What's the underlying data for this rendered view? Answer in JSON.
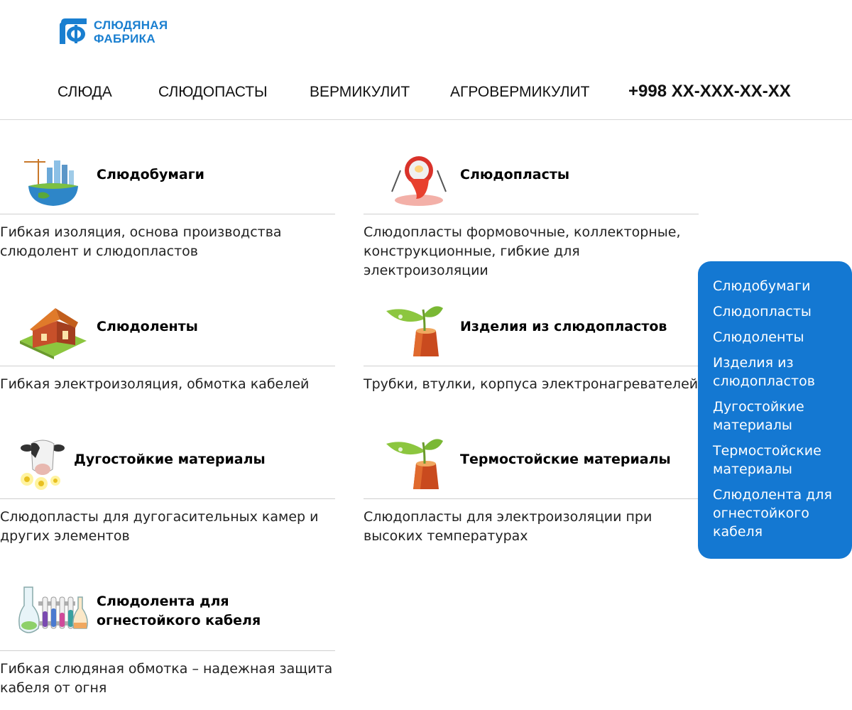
{
  "logo": {
    "line1": "СЛЮДЯНАЯ",
    "line2": "ФАБРИКА"
  },
  "nav": {
    "items": [
      "СЛЮДА",
      "СЛЮДОПАСТЫ",
      "ВЕРМИКУЛИТ",
      "АГРОВЕРМИКУЛИТ"
    ],
    "phone": "+998 XX-XXX-XX-XX"
  },
  "cards": [
    {
      "title": "Слюдобумаги",
      "description": "Гибкая изоляция, основа производства слюдолент и слюдопластов",
      "icon": "globe-city-icon"
    },
    {
      "title": "Слюдопласты",
      "description": "Слюдопласты формовочные, коллекторные, конструкционные, гибкие для электроизоляции",
      "icon": "lab-flask-icon"
    },
    {
      "title": "Слюдоленты",
      "description": "Гибкая электроизоляция, обмотка кабелей",
      "icon": "house-icon"
    },
    {
      "title": "Изделия из слюдопластов",
      "description": "Трубки, втулки, корпуса электронагревателей",
      "icon": "sprout-stump-icon"
    },
    {
      "title": "Дугостойкие материалы",
      "description": "Слюдопласты для дугогасительных камер и других элементов",
      "icon": "cow-flowers-icon"
    },
    {
      "title": "Термостойские материалы",
      "description": "Слюдопласты для электроизоляции при высоких температурах",
      "icon": "sprout-stump-icon"
    },
    {
      "title": "Слюдолента для огнестойкого кабеля",
      "description": "Гибкая слюдяная обмотка – надежная защита кабеля от огня",
      "icon": "test-tubes-icon"
    }
  ],
  "sidebar": {
    "items": [
      "Слюдобумаги",
      "Слюдопласты",
      "Слюдоленты",
      "Изделия из слюдопластов",
      "Дугостойкие материалы",
      "Термостойские материалы",
      "Слюдолента для огнестойкого кабеля"
    ]
  },
  "colors": {
    "accent": "#1478d2",
    "logo": "#1a7fd0"
  }
}
